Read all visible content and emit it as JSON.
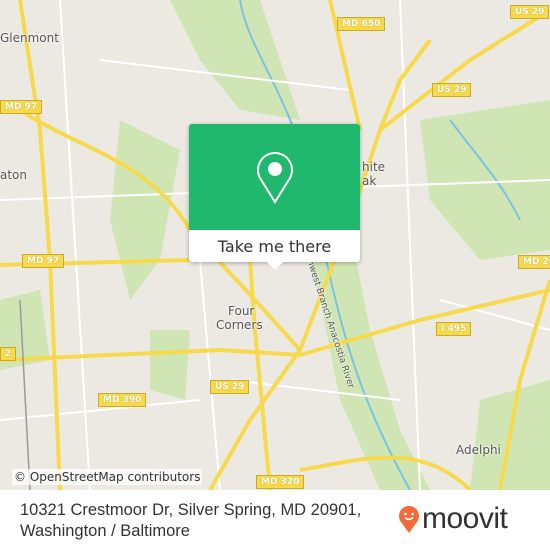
{
  "map": {
    "place_labels": [
      "Glenmont",
      "aton",
      "hite",
      "ak",
      "Four",
      "Corners",
      "Adelphi"
    ],
    "river_label": "Northwest Branch Anacostia River",
    "shields": [
      "MD 650",
      "US 29",
      "MD 97",
      "US 29",
      "MD 97",
      "MD 29",
      "I 495",
      "2",
      "US 29",
      "MD 390",
      "MD 320"
    ],
    "attribution": "© OpenStreetMap contributors",
    "colors": {
      "land": "#ece8e2",
      "park": "#cfe6b4",
      "road": "#f7d94c",
      "water": "#7cc2e0"
    }
  },
  "popup": {
    "button_label": "Take me there",
    "icon": "map-pin-icon",
    "color": "#1fb86c"
  },
  "footer": {
    "address_line1": "10321 Crestmoor Dr, Silver Spring, MD 20901,",
    "address_line2": "Washington / Baltimore"
  },
  "brand": {
    "name": "moovit",
    "color": "#f26b3a"
  }
}
